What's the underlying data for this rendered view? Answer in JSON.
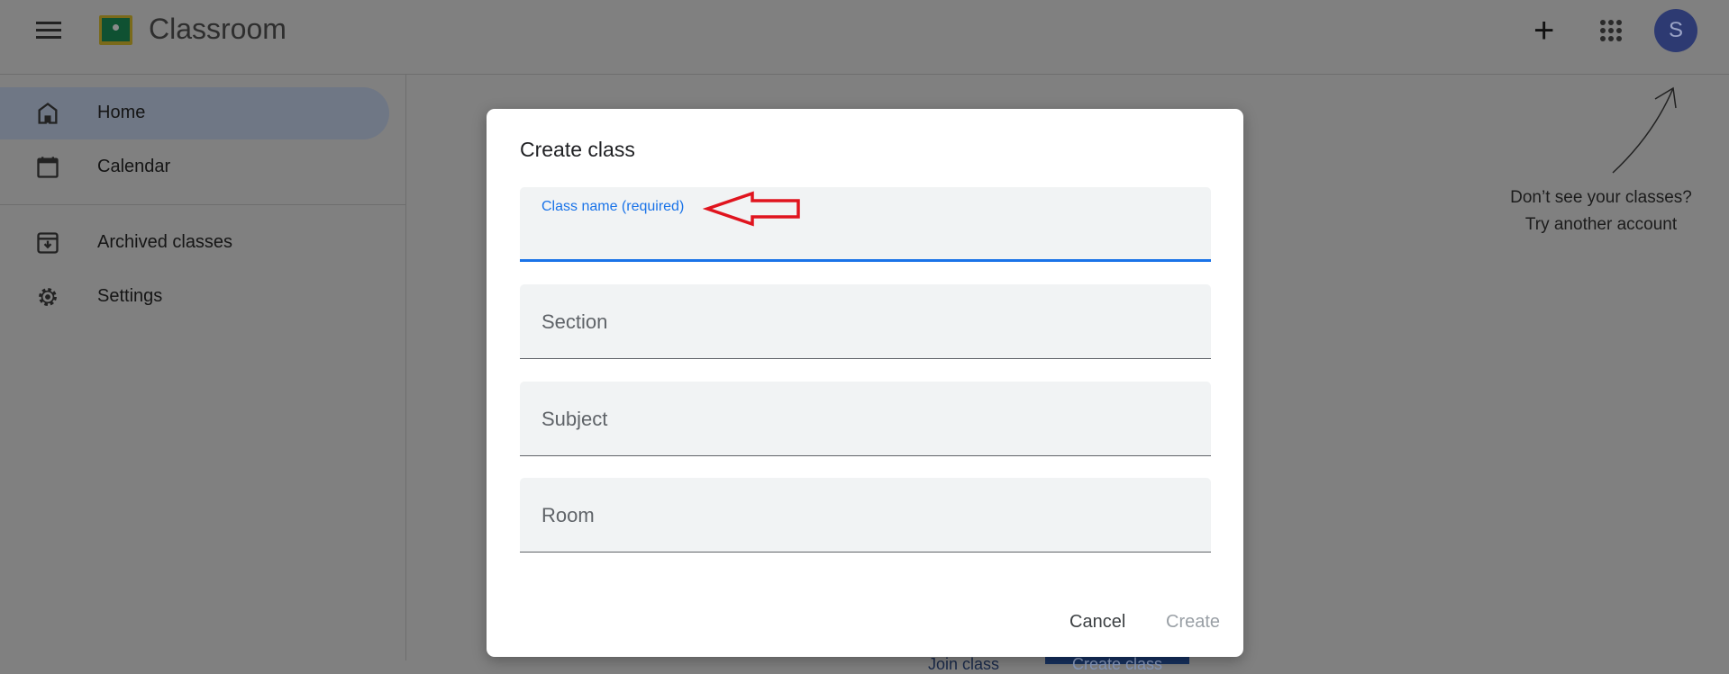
{
  "header": {
    "title": "Classroom",
    "avatar_letter": "S",
    "icons": [
      "menu-icon",
      "classroom-logo",
      "plus-icon",
      "apps-grid-icon"
    ]
  },
  "sidebar": {
    "items": [
      {
        "label": "Home",
        "icon": "home-icon",
        "active": true
      },
      {
        "label": "Calendar",
        "icon": "calendar-icon"
      },
      {
        "label": "Archived classes",
        "icon": "archive-icon"
      },
      {
        "label": "Settings",
        "icon": "gear-icon"
      }
    ]
  },
  "hint": {
    "line1": "Don’t see your classes?",
    "line2": "Try another account"
  },
  "background_buttons": {
    "join": "Join class",
    "create": "Create class"
  },
  "dialog": {
    "title": "Create class",
    "fields": {
      "class_name": {
        "label": "Class name (required)",
        "value": ""
      },
      "section": {
        "placeholder": "Section"
      },
      "subject": {
        "placeholder": "Subject"
      },
      "room": {
        "placeholder": "Room"
      }
    },
    "cancel_label": "Cancel",
    "create_label": "Create"
  },
  "colors": {
    "accent": "#1a73e8",
    "annotation": "#e0141e",
    "avatar": "#3f51b5"
  }
}
